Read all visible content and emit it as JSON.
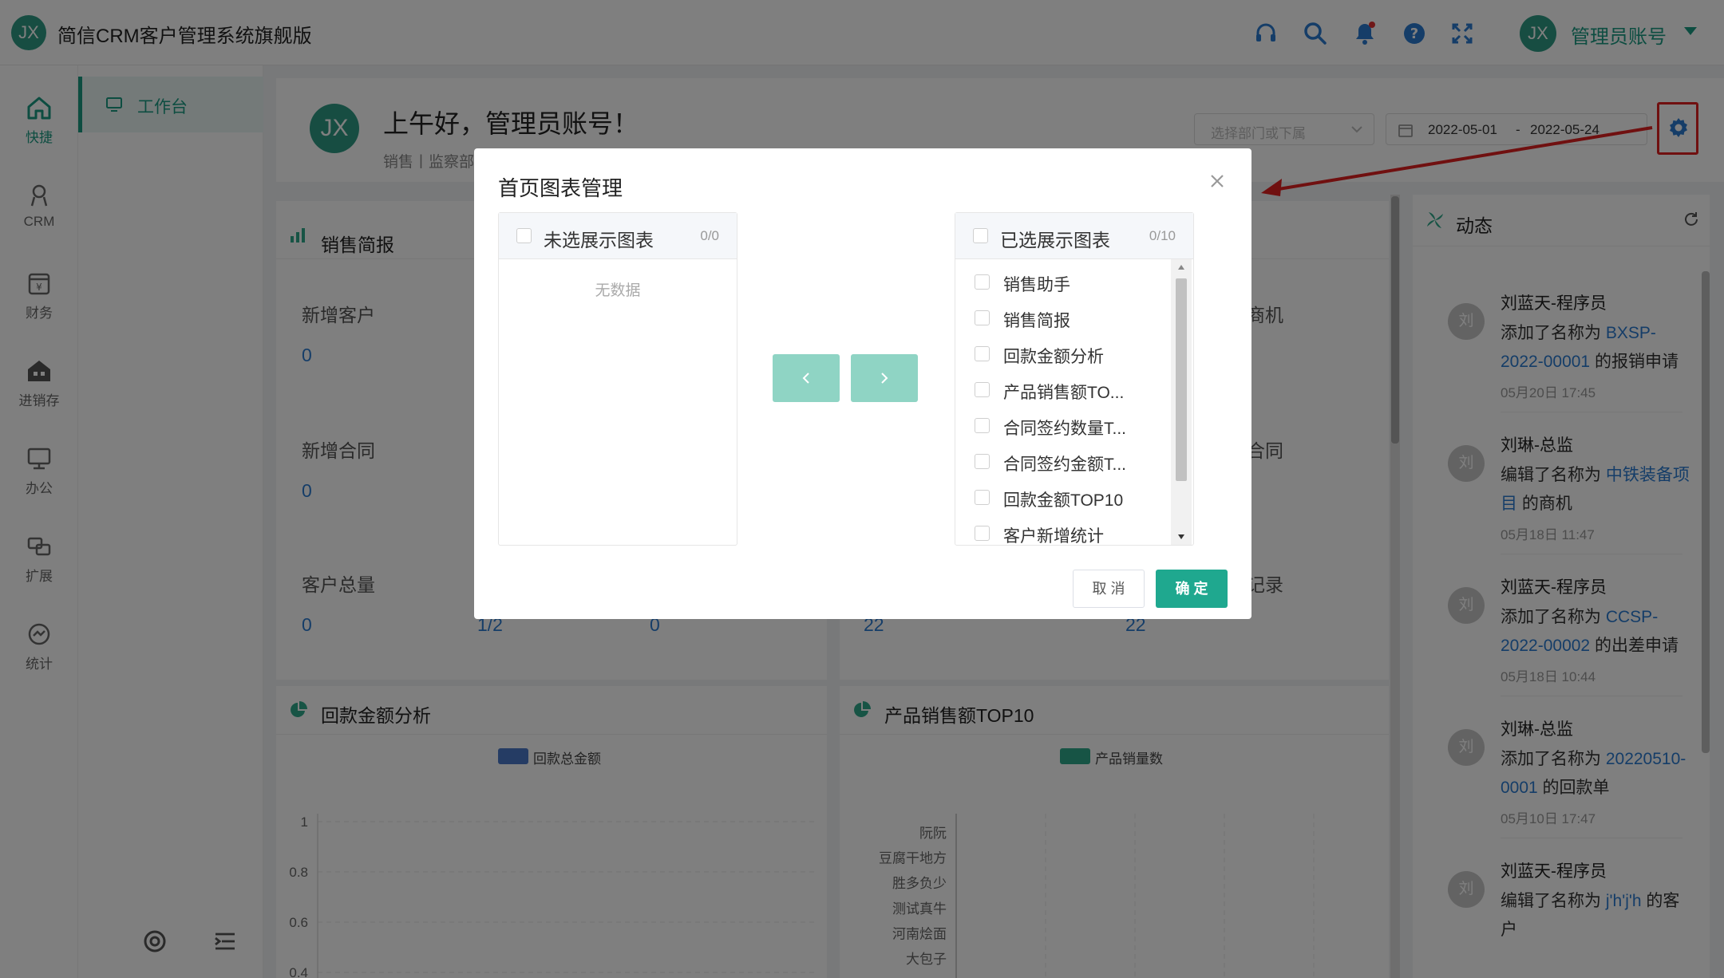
{
  "header": {
    "logo_text": "JX",
    "app_title": "简信CRM客户管理系统旗舰版",
    "user_avatar_text": "JX",
    "username": "管理员账号"
  },
  "rail": {
    "items": [
      {
        "label": "快捷",
        "icon": "home-icon"
      },
      {
        "label": "CRM",
        "icon": "user-icon"
      },
      {
        "label": "财务",
        "icon": "finance-icon"
      },
      {
        "label": "进销存",
        "icon": "store-icon"
      },
      {
        "label": "办公",
        "icon": "monitor-icon"
      },
      {
        "label": "扩展",
        "icon": "extend-icon"
      },
      {
        "label": "统计",
        "icon": "stats-icon"
      }
    ]
  },
  "subnav": {
    "active_label": "工作台"
  },
  "greeting": {
    "avatar_text": "JX",
    "title": "上午好，管理员账号！",
    "subtitle": "销售丨监察部",
    "dept_placeholder": "选择部门或下属",
    "date_start": "2022-05-01",
    "date_sep": "-",
    "date_end": "2022-05-24"
  },
  "sales_brief": {
    "title": "销售简报",
    "labels": [
      "新增客户",
      "新增合同",
      "客户总量"
    ],
    "values": [
      "0",
      "0",
      "0",
      "1/2",
      "0"
    ],
    "right_labels": [
      "商机",
      "合同",
      "记录"
    ],
    "right_values": [
      "22",
      "22"
    ]
  },
  "dynamics": {
    "title": "动态",
    "items": [
      {
        "avatar": "刘",
        "name": "刘蓝天-程序员",
        "pre": "添加了名称为 ",
        "link": "BXSP-2022-00001",
        "post": " 的报销申请",
        "time": "05月20日 17:45"
      },
      {
        "avatar": "刘",
        "name": "刘琳-总监",
        "pre": "编辑了名称为 ",
        "link": "中铁装备项目",
        "post": " 的商机",
        "time": "05月18日 11:47"
      },
      {
        "avatar": "刘",
        "name": "刘蓝天-程序员",
        "pre": "添加了名称为 ",
        "link": "CCSP-2022-00002",
        "post": " 的出差申请",
        "time": "05月18日 10:44"
      },
      {
        "avatar": "刘",
        "name": "刘琳-总监",
        "pre": "添加了名称为 ",
        "link": "20220510-0001",
        "post": " 的回款单",
        "time": "05月10日 17:47"
      },
      {
        "avatar": "刘",
        "name": "刘蓝天-程序员",
        "pre": "编辑了名称为 ",
        "link": "j'h'j'h",
        "post": " 的客户",
        "time": ""
      }
    ]
  },
  "chart_data": [
    {
      "type": "line",
      "title": "回款金额分析",
      "series": [
        {
          "name": "回款总金额",
          "values": []
        }
      ],
      "ytick_labels": [
        "1",
        "0.8",
        "0.6",
        "0.4"
      ],
      "color": "#4a78c9"
    },
    {
      "type": "bar",
      "title": "产品销售额TOP10",
      "series": [
        {
          "name": "产品销量数",
          "values": []
        }
      ],
      "categories": [
        "阮阮",
        "豆腐干地方",
        "胜多负少",
        "测试真牛",
        "河南烩面",
        "大包子"
      ],
      "color": "#2fa88a"
    }
  ],
  "modal": {
    "title": "首页图表管理",
    "left_panel": {
      "title": "未选展示图表",
      "count": "0/0",
      "empty_text": "无数据"
    },
    "right_panel": {
      "title": "已选展示图表",
      "count": "0/10",
      "items": [
        "销售助手",
        "销售简报",
        "回款金额分析",
        "产品销售额TO...",
        "合同签约数量T...",
        "合同签约金额T...",
        "回款金额TOP10",
        "客户新增统计"
      ]
    },
    "cancel_label": "取 消",
    "ok_label": "确 定"
  }
}
